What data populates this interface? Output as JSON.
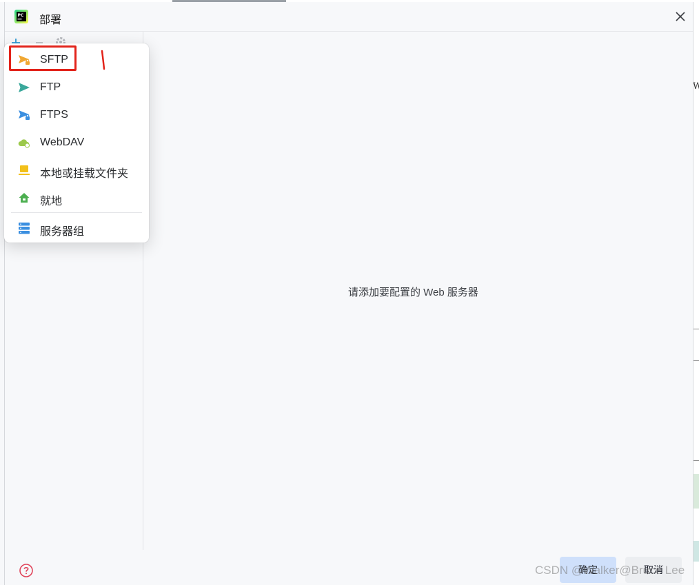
{
  "window": {
    "title": "部署"
  },
  "toolbar": {
    "add": "add",
    "remove": "remove",
    "settings": "settings"
  },
  "menu": {
    "items": [
      {
        "label": "SFTP",
        "icon": "sftp-icon",
        "color": "#f0a732"
      },
      {
        "label": "FTP",
        "icon": "ftp-icon",
        "color": "#3aa89b"
      },
      {
        "label": "FTPS",
        "icon": "ftps-icon",
        "color": "#3b8fe0"
      },
      {
        "label": "WebDAV",
        "icon": "webdav-icon",
        "color": "#9bc94a"
      },
      {
        "label": "本地或挂载文件夹",
        "icon": "folder-icon",
        "color": "#f2c01b"
      },
      {
        "label": "就地",
        "icon": "home-icon",
        "color": "#4caf50"
      },
      {
        "label": "服务器组",
        "icon": "server-group-icon",
        "color": "#3b8fe0"
      }
    ]
  },
  "main": {
    "empty_message": "请添加要配置的 Web 服务器"
  },
  "footer": {
    "ok_label": "确定",
    "cancel_label": "取消"
  },
  "watermark": "CSDN @Walker@Bruce Lee",
  "colors": {
    "accent": "#cfe0fb",
    "highlight": "#e2231a",
    "background": "#f7f8fa"
  }
}
